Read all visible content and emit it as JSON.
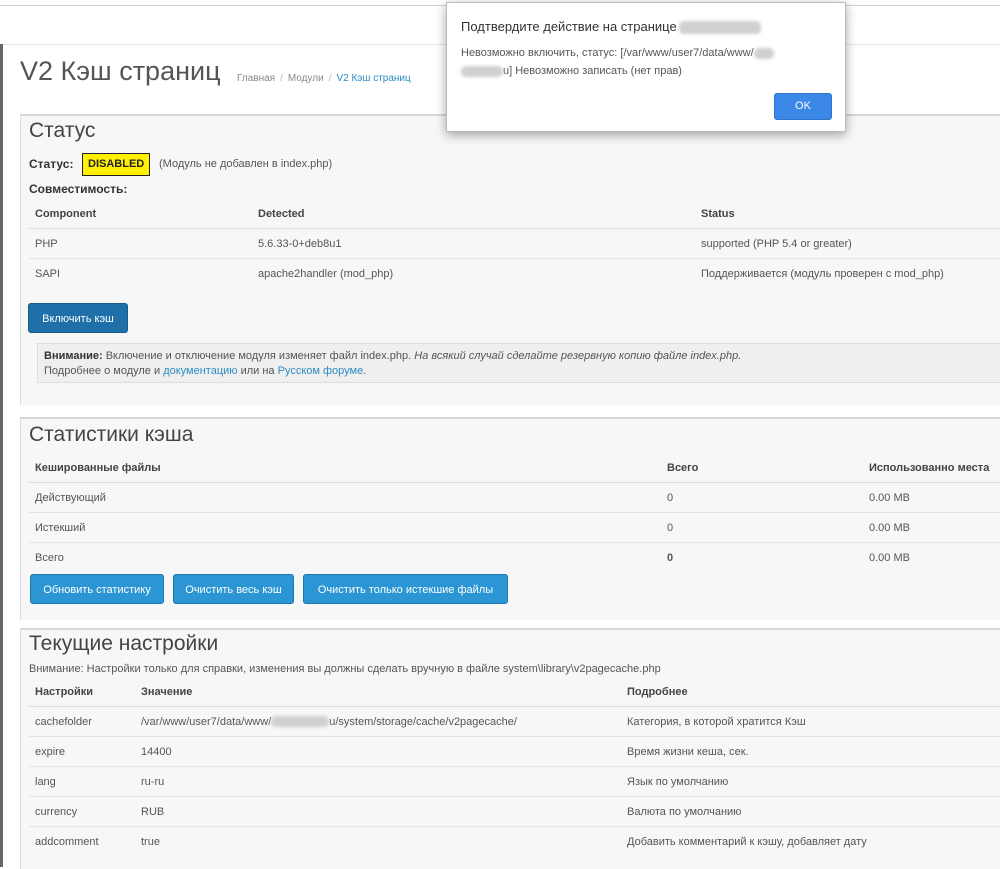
{
  "dialog": {
    "title": "Подтвердите действие на странице",
    "message_part1": "Невозможно включить, статус: [/var/www/user7/data/www/",
    "message_part2": "u] Невозможно записать (нет прав)",
    "ok_label": "OK"
  },
  "header": {
    "title": "V2 Кэш страниц",
    "breadcrumb": [
      "Главная",
      "Модули",
      "V2 Кэш страниц"
    ]
  },
  "status_panel": {
    "heading": "Статус",
    "status_label": "Статус:",
    "status_badge": "DISABLED",
    "status_note": "(Модуль не добавлен в index.php)",
    "compat_label": "Совместимость:",
    "columns": [
      "Component",
      "Detected",
      "Status"
    ],
    "rows": [
      [
        "PHP",
        "5.6.33-0+deb8u1",
        "supported (PHP 5.4 or greater)"
      ],
      [
        "SAPI",
        "apache2handler (mod_php)",
        "Поддерживается (модуль проверен с mod_php)"
      ]
    ],
    "enable_button": "Включить кэш",
    "notice": {
      "bold": "Внимание:",
      "text": " Включение и отключение модуля изменяет файл index.php.",
      "italic": "На всякий случай сделайте резервную копию файле index.php.",
      "line2_prefix": "Подробнее о модуле и ",
      "docs_link": "документацию",
      "line2_mid": " или на ",
      "forum_link": "Русском форуме",
      "line2_suffix": "."
    }
  },
  "stats_panel": {
    "heading": "Статистики кэша",
    "columns": [
      "Кешированные файлы",
      "Всего",
      "Использованно места"
    ],
    "rows": [
      [
        "Действующий",
        "0",
        "0.00 MB"
      ],
      [
        "Истекший",
        "0",
        "0.00 MB"
      ],
      [
        "Всего",
        "0",
        "0.00 MB"
      ]
    ],
    "buttons": [
      "Обновить статистику",
      "Очистить весь кэш",
      "Очистить только истекшие файлы"
    ]
  },
  "settings_panel": {
    "heading": "Текущие настройки",
    "note": "Внимание: Настройки только для справки, изменения вы должны сделать вручную в файле system\\library\\v2pagecache.php",
    "columns": [
      "Настройки",
      "Значение",
      "Подробнее"
    ],
    "cachefolder_value_prefix": "/var/www/user7/data/www/",
    "cachefolder_value_suffix": "u/system/storage/cache/v2pagecache/",
    "rows": [
      [
        "cachefolder",
        "",
        "Категория, в которой хратится Кэш"
      ],
      [
        "expire",
        "14400",
        "Время жизни кеша, сек."
      ],
      [
        "lang",
        "ru-ru",
        "Язык по умолчанию"
      ],
      [
        "currency",
        "RUB",
        "Валюта по умолчанию"
      ],
      [
        "addcomment",
        "true",
        "Добавить комментарий к кэшу, добавляет дату"
      ]
    ]
  }
}
